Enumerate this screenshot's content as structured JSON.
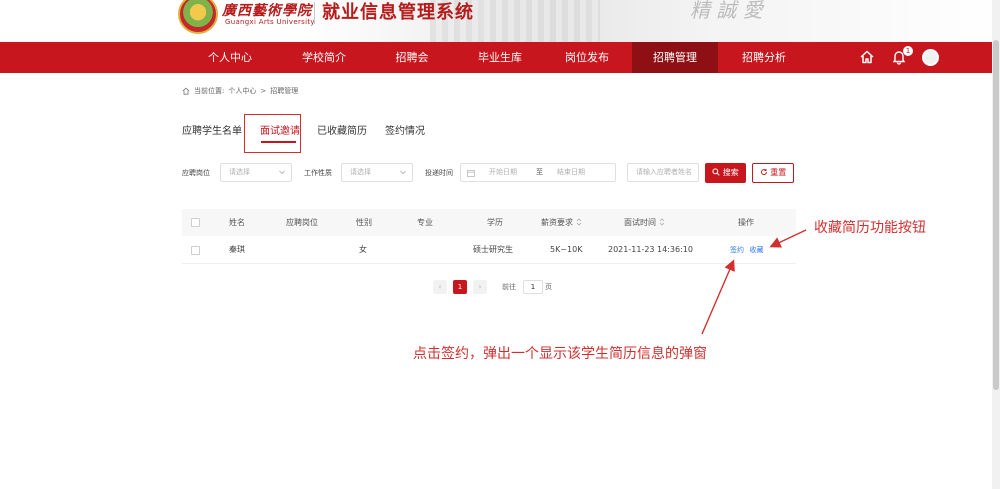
{
  "header": {
    "school_name_cn": "廣西藝術學院",
    "school_name_en": "Guangxi Arts University",
    "system_title": "就业信息管理系统",
    "calligraphy": "精 誠 愛"
  },
  "nav": {
    "items": [
      {
        "label": "个人中心"
      },
      {
        "label": "学校简介"
      },
      {
        "label": "招聘会"
      },
      {
        "label": "毕业生库"
      },
      {
        "label": "岗位发布"
      },
      {
        "label": "招聘管理"
      },
      {
        "label": "招聘分析"
      }
    ],
    "active_index": 5,
    "notification_count": "1"
  },
  "breadcrumb": {
    "prefix": "当前位置:",
    "path1": "个人中心",
    "separator": ">",
    "path2": "招聘管理"
  },
  "tabs": [
    {
      "label": "应聘学生名单"
    },
    {
      "label": "面试邀请"
    },
    {
      "label": "已收藏简历"
    },
    {
      "label": "签约情况"
    }
  ],
  "filters": {
    "position_label": "应聘岗位",
    "position_placeholder": "请选择",
    "jobtype_label": "工作性质",
    "jobtype_placeholder": "请选择",
    "time_label": "投递时间",
    "start_placeholder": "开始日期",
    "range_sep": "至",
    "end_placeholder": "结束日期",
    "name_placeholder": "请输入应聘者姓名",
    "search_label": "搜索",
    "reset_label": "重置"
  },
  "table": {
    "headers": {
      "name": "姓名",
      "position": "应聘岗位",
      "gender": "性别",
      "major": "专业",
      "education": "学历",
      "salary": "薪资要求",
      "interview_time": "面试时间",
      "action": "操作"
    },
    "rows": [
      {
        "name": "秦琪",
        "position": "",
        "gender": "女",
        "major": "",
        "education": "硕士研究生",
        "salary": "5K~10K",
        "interview_time": "2021-11-23 14:36:10",
        "action_sign": "签约",
        "action_collect": "收藏"
      }
    ]
  },
  "pagination": {
    "current_page": "1",
    "goto_label": "前往",
    "goto_value": "1",
    "page_suffix": "页"
  },
  "annotations": {
    "collect_note": "收藏简历功能按钮",
    "sign_note": "点击签约，弹出一个显示该学生简历信息的弹窗"
  },
  "colors": {
    "brand_red": "#c8161e",
    "nav_active": "#8e0f14",
    "link_blue": "#2f7cf6",
    "annotation_red": "#d32f2f"
  },
  "icons": [
    "home-icon",
    "bell-icon",
    "avatar",
    "chevron-down-icon",
    "calendar-icon",
    "search-icon",
    "refresh-icon",
    "sort-icon"
  ]
}
